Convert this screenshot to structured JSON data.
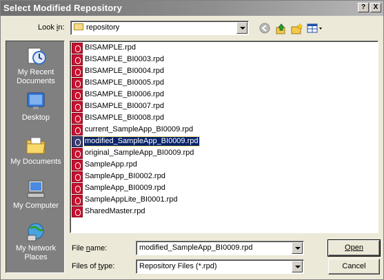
{
  "window": {
    "title": "Select Modified Repository",
    "help_label": "?",
    "close_label": "X"
  },
  "lookin": {
    "label": "Look in:",
    "value": "repository"
  },
  "places": [
    {
      "label": "My Recent Documents",
      "icon": "recent-documents-icon"
    },
    {
      "label": "Desktop",
      "icon": "desktop-icon"
    },
    {
      "label": "My Documents",
      "icon": "my-documents-icon"
    },
    {
      "label": "My Computer",
      "icon": "my-computer-icon"
    },
    {
      "label": "My Network Places",
      "icon": "network-places-icon"
    }
  ],
  "files": [
    "BISAMPLE.rpd",
    "BISAMPLE_BI0003.rpd",
    "BISAMPLE_BI0004.rpd",
    "BISAMPLE_BI0005.rpd",
    "BISAMPLE_BI0006.rpd",
    "BISAMPLE_BI0007.rpd",
    "BISAMPLE_BI0008.rpd",
    "current_SampleApp_BI0009.rpd",
    "modified_SampleApp_BI0009.rpd",
    "original_SampleApp_BI0009.rpd",
    "SampleApp.rpd",
    "SampleApp_BI0002.rpd",
    "SampleApp_BI0009.rpd",
    "SampleAppLite_BI0001.rpd",
    "SharedMaster.rpd"
  ],
  "selected_file": "modified_SampleApp_BI0009.rpd",
  "filename": {
    "label": "File name:",
    "value": "modified_SampleApp_BI0009.rpd"
  },
  "filetype": {
    "label": "Files of type:",
    "value": "Repository Files (*.rpd)"
  },
  "buttons": {
    "open": "Open",
    "cancel": "Cancel"
  }
}
